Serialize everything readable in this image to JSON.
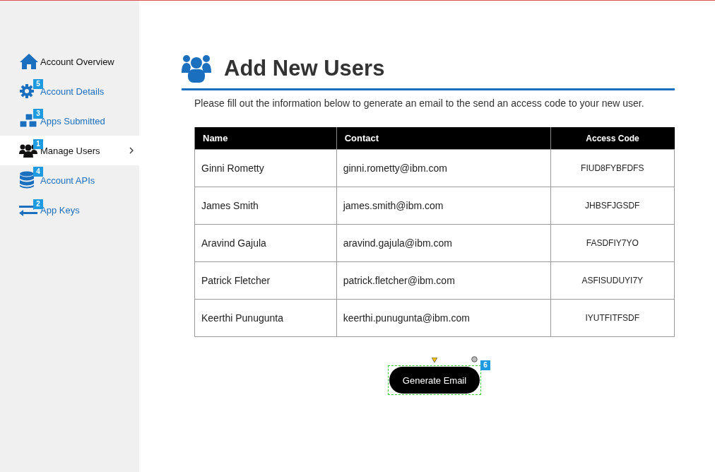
{
  "sidebar": {
    "items": [
      {
        "label": "Account Overview",
        "selected": false
      },
      {
        "label": "Account Details",
        "selected": false,
        "badge": "5"
      },
      {
        "label": "Apps Submitted",
        "selected": false,
        "badge": "3"
      },
      {
        "label": "Manage Users",
        "selected": true,
        "badge": "1"
      },
      {
        "label": "Account APIs",
        "selected": false,
        "badge": "4"
      },
      {
        "label": "App Keys",
        "selected": false,
        "badge": "2"
      }
    ]
  },
  "header": {
    "title": "Add New Users",
    "subtitle": "Please fill out the information below to generate an email to the send an access code to your new user."
  },
  "table": {
    "columns": [
      "Name",
      "Contact",
      "Access Code"
    ],
    "rows": [
      [
        "Ginni Rometty",
        "ginni.rometty@ibm.com",
        "FIUD8FYBFDFS"
      ],
      [
        "James Smith",
        "james.smith@ibm.com",
        "JHBSFJGSDF"
      ],
      [
        "Aravind Gajula",
        "aravind.gajula@ibm.com",
        "FASDFIY7YO"
      ],
      [
        "Patrick Fletcher",
        "patrick.fletcher@ibm.com",
        "ASFISUDUYI7Y"
      ],
      [
        "Keerthi Punugunta",
        "keerthi.punugunta@ibm.com",
        "IYUTFITFSDF"
      ]
    ]
  },
  "button": {
    "label": "Generate Email",
    "badge": "6",
    "selected": true
  }
}
